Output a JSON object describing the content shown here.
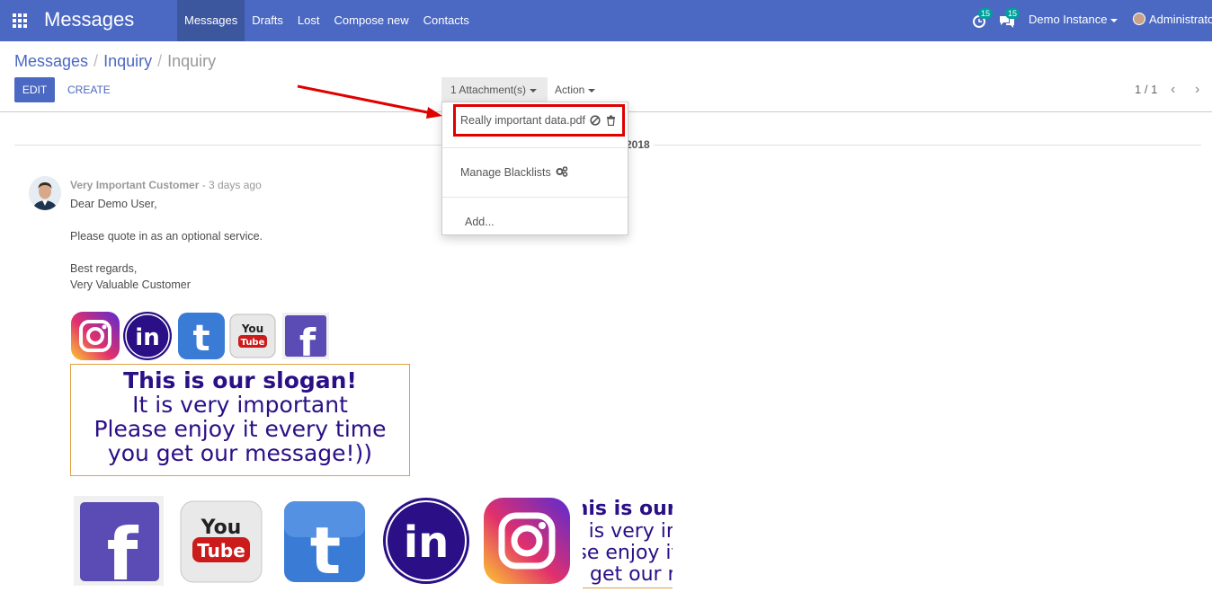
{
  "navbar": {
    "app_title": "Messages",
    "menu": [
      "Messages",
      "Drafts",
      "Lost",
      "Compose new",
      "Contacts"
    ],
    "activity_badge": "15",
    "chat_badge": "15",
    "instance": "Demo Instance",
    "user": "Administrator"
  },
  "breadcrumb": [
    "Messages",
    "Inquiry",
    "Inquiry"
  ],
  "buttons": {
    "edit": "EDIT",
    "create": "CREATE",
    "attachments": "1 Attachment(s)",
    "action": "Action"
  },
  "pager": {
    "value": "1 / 1"
  },
  "date_separator": "2018",
  "dropdown": {
    "attachment_name": "Really important data.pdf",
    "manage_blacklists": "Manage Blacklists",
    "add": "Add..."
  },
  "message": {
    "author": "Very Important Customer",
    "date": "- 3 days ago",
    "greeting": "Dear Demo User,",
    "body": "Please quote in as an optional service.",
    "closing": "Best regards,",
    "signature": "Very Valuable Customer"
  },
  "slogan": {
    "line1": "This is our slogan!",
    "line2": "It is very important",
    "line3": "Please enjoy it every time",
    "line4": "you get our message!))"
  },
  "social_icons": [
    "instagram-icon",
    "linkedin-icon",
    "twitter-icon",
    "youtube-icon",
    "facebook-icon"
  ],
  "colors": {
    "navbar": "#4b68c2",
    "slogan": "#2a0f86",
    "highlight": "#e00000"
  }
}
